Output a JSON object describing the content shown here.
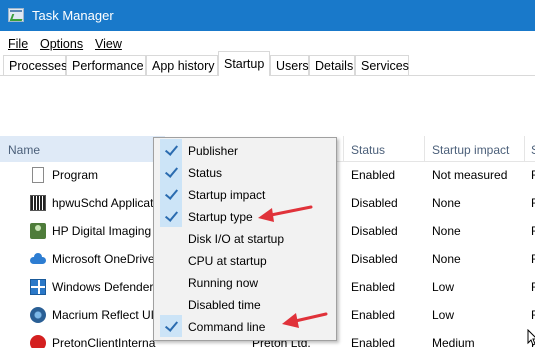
{
  "window": {
    "title": "Task Manager",
    "title_bar_color": "#1979ca"
  },
  "menu": {
    "file": "File",
    "options": "Options",
    "view": "View"
  },
  "tabs": [
    {
      "label": "Processes"
    },
    {
      "label": "Performance"
    },
    {
      "label": "App history"
    },
    {
      "label": "Startup",
      "active": true
    },
    {
      "label": "Users"
    },
    {
      "label": "Details"
    },
    {
      "label": "Services"
    }
  ],
  "columns": {
    "name": "Name",
    "status": "Status",
    "impact": "Startup impact",
    "extra_partial": "S"
  },
  "rows": [
    {
      "name": "Program",
      "publisher": "",
      "status": "Enabled",
      "impact": "Not measured",
      "extra": "F",
      "icon": "blank-document-icon"
    },
    {
      "name": "hpwuSchd Applicat",
      "publisher": "",
      "status": "Disabled",
      "impact": "None",
      "extra": "F",
      "icon": "barcode-app-icon"
    },
    {
      "name": "HP Digital Imaging",
      "publisher": "",
      "status": "Disabled",
      "impact": "None",
      "extra": "F",
      "icon": "hp-imaging-icon"
    },
    {
      "name": "Microsoft OneDrive",
      "publisher": "",
      "status": "Disabled",
      "impact": "None",
      "extra": "F",
      "icon": "onedrive-cloud-icon"
    },
    {
      "name": "Windows Defender",
      "publisher": "",
      "status": "Enabled",
      "impact": "Low",
      "extra": "F",
      "icon": "windows-defender-icon"
    },
    {
      "name": "Macrium Reflect UI",
      "publisher": "",
      "status": "Enabled",
      "impact": "Low",
      "extra": "F",
      "icon": "macrium-reflect-icon"
    },
    {
      "name": "PretonClientInternal",
      "publisher": "Preton Ltd.",
      "status": "Enabled",
      "impact": "Medium",
      "extra": "F",
      "icon": "preton-icon"
    }
  ],
  "context_menu": {
    "items": [
      {
        "label": "Publisher",
        "checked": true
      },
      {
        "label": "Status",
        "checked": true
      },
      {
        "label": "Startup impact",
        "checked": true
      },
      {
        "label": "Startup type",
        "checked": true
      },
      {
        "label": "Disk I/O at startup",
        "checked": false
      },
      {
        "label": "CPU at startup",
        "checked": false
      },
      {
        "label": "Running now",
        "checked": false
      },
      {
        "label": "Disabled time",
        "checked": false
      },
      {
        "label": "Command line",
        "checked": true
      }
    ],
    "highlighted": [
      "Startup type",
      "Command line"
    ]
  },
  "colors": {
    "accent": "#1979ca",
    "arrow": "#e0323a",
    "check_bg": "#cce4f7",
    "header_highlight": "#dfeaf7"
  }
}
